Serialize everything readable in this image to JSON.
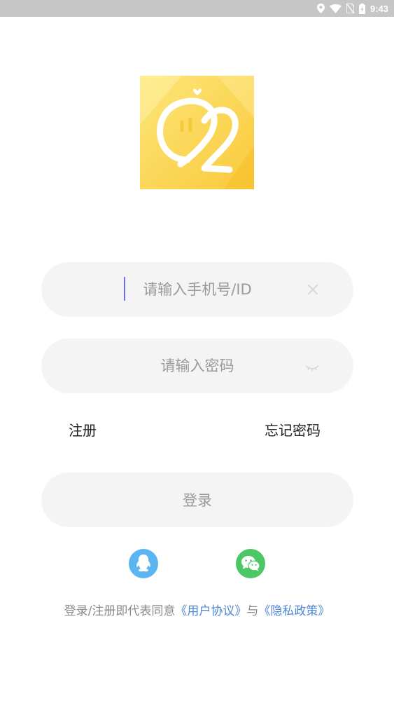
{
  "status_bar": {
    "time": "9:43",
    "icons": [
      "location-icon",
      "wifi-icon",
      "no-sim-icon",
      "battery-icon"
    ]
  },
  "logo": {
    "text": "92",
    "icon": "app-logo-icon"
  },
  "phone_input": {
    "placeholder": "请输入手机号/ID",
    "value": ""
  },
  "password_input": {
    "placeholder": "请输入密码",
    "value": ""
  },
  "links": {
    "register": "注册",
    "forgot_password": "忘记密码"
  },
  "login_button": "登录",
  "social": {
    "qq_icon": "qq-icon",
    "wechat_icon": "wechat-icon"
  },
  "agreement": {
    "prefix": "登录/注册即代表同意",
    "user_agreement": "《用户协议》",
    "conjunction": "与",
    "privacy_policy": "《隐私政策》"
  },
  "colors": {
    "status_bar": "#c6c6c6",
    "field_bg": "#f4f4f4",
    "link": "#4f86d6",
    "qq": "#5bb5f0",
    "wechat": "#4cc765",
    "logo_yellow": "#fcd544"
  }
}
